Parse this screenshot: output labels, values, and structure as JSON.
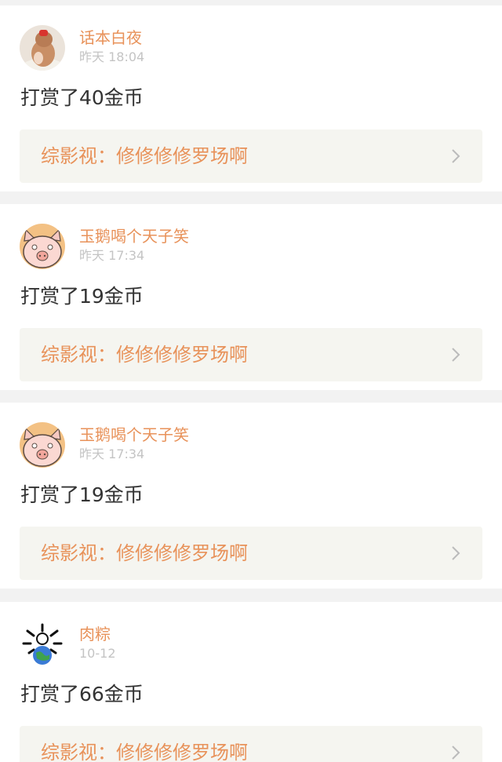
{
  "feed": {
    "items": [
      {
        "user": "话本白夜",
        "time": "昨天 18:04",
        "action": "打赏了40金币",
        "work": "综影视：修修修修罗场啊",
        "avatar_icon": "girl-bun-avatar",
        "chevron_icon": "chevron-right-icon"
      },
      {
        "user": "玉鹅喝个天子笑",
        "time": "昨天 17:34",
        "action": "打赏了19金币",
        "work": "综影视：修修修修罗场啊",
        "avatar_icon": "pig-cartoon-avatar",
        "chevron_icon": "chevron-right-icon"
      },
      {
        "user": "玉鹅喝个天子笑",
        "time": "昨天 17:34",
        "action": "打赏了19金币",
        "work": "综影视：修修修修罗场啊",
        "avatar_icon": "pig-cartoon-avatar",
        "chevron_icon": "chevron-right-icon"
      },
      {
        "user": "肉粽",
        "time": "10-12",
        "action": "打赏了66金币",
        "work": "综影视：修修修修罗场啊",
        "avatar_icon": "bone-globe-avatar",
        "chevron_icon": "chevron-right-icon"
      }
    ]
  },
  "colors": {
    "accent": "#e8925a",
    "time": "#c4c4c4",
    "text": "#333333",
    "link_bg": "#f5f5f0",
    "page_bg": "#f2f2f2"
  }
}
